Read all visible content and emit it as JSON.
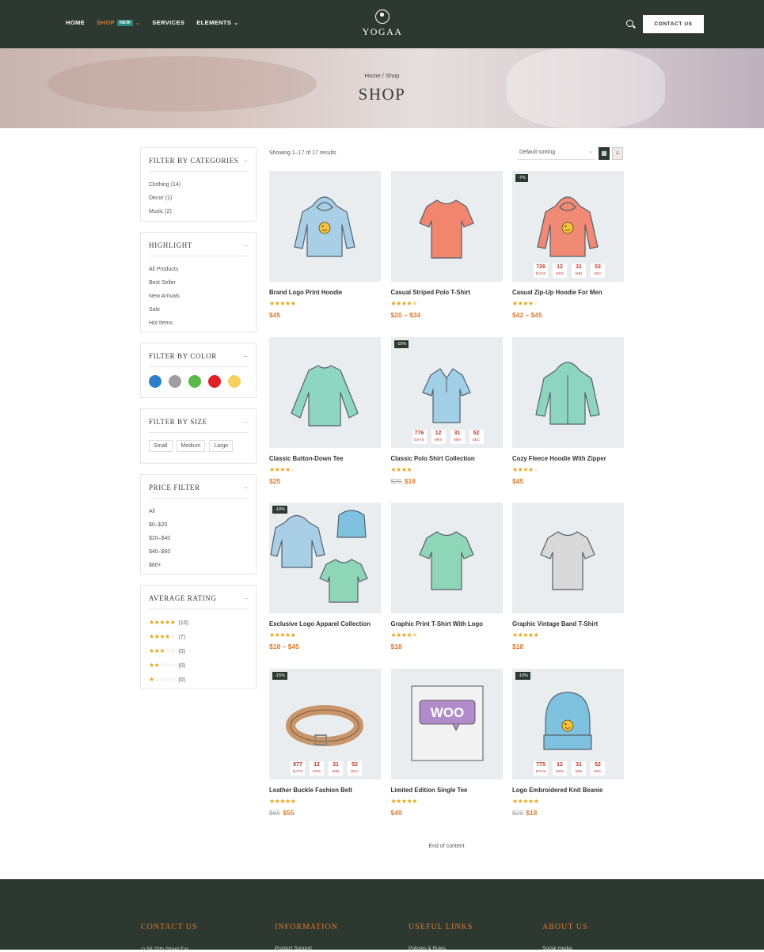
{
  "header": {
    "nav": [
      {
        "label": "HOME"
      },
      {
        "label": "SHOP",
        "badge": "NEW",
        "active": true
      },
      {
        "label": "SERVICES"
      },
      {
        "label": "ELEMENTS"
      }
    ],
    "logo_text": "YOGAA",
    "contact_label": "CONTACT US"
  },
  "hero": {
    "breadcrumb": "Home / Shop",
    "title": "SHOP"
  },
  "sidebar": {
    "categories": {
      "title": "FILTER BY CATEGORIES",
      "items": [
        "Clothing (14)",
        "Decor (1)",
        "Music (2)"
      ]
    },
    "highlight": {
      "title": "HIGHLIGHT",
      "items": [
        "All Products",
        "Best Seller",
        "New Arrivals",
        "Sale",
        "Hot Items"
      ]
    },
    "color": {
      "title": "FILTER BY COLOR",
      "colors": [
        "#2e7fc9",
        "#9e9e9e",
        "#58b94a",
        "#df2026",
        "#f7d060"
      ]
    },
    "size": {
      "title": "FILTER BY SIZE",
      "items": [
        "Small",
        "Medium",
        "Large"
      ]
    },
    "price": {
      "title": "PRICE FILTER",
      "items": [
        "All",
        "$0–$20",
        "$20–$40",
        "$40–$60",
        "$80+"
      ]
    },
    "rating": {
      "title": "AVERAGE RATING",
      "items": [
        {
          "stars": 5,
          "count": "(10)"
        },
        {
          "stars": 4,
          "count": "(7)"
        },
        {
          "stars": 3,
          "count": "(0)"
        },
        {
          "stars": 2,
          "count": "(0)"
        },
        {
          "stars": 1,
          "count": "(0)"
        }
      ]
    }
  },
  "toolbar": {
    "showing": "Showing 1–17 of 17 results",
    "sort": "Default sorting"
  },
  "products": [
    {
      "name": "Brand Logo Print Hoodie",
      "price": "$45",
      "rating": 5,
      "icon": "hoodie",
      "color": "#a9cfe6"
    },
    {
      "name": "Casual Striped Polo T-Shirt",
      "price": "$20 – $34",
      "rating": 4.5,
      "icon": "tshirt",
      "color": "#f2856e"
    },
    {
      "name": "Casual Zip-Up Hoodie For Men",
      "price": "$42 – $45",
      "rating": 4,
      "icon": "hoodie",
      "color": "#f08a74",
      "tag": "-7%",
      "countdown": [
        "726",
        "12",
        "31",
        "53"
      ]
    },
    {
      "name": "Classic Button-Down Tee",
      "price": "$25",
      "rating": 4,
      "icon": "longsleeve",
      "color": "#8fd6c0"
    },
    {
      "name": "Classic Polo Shirt Collection",
      "old": "$20",
      "price": "$18",
      "rating": 4,
      "icon": "polo",
      "color": "#a2cfe8",
      "tag": "-10%",
      "countdown": [
        "776",
        "12",
        "31",
        "52"
      ]
    },
    {
      "name": "Cozy Fleece Hoodie With Zipper",
      "price": "$45",
      "rating": 4,
      "icon": "zip",
      "color": "#8dd5be"
    },
    {
      "name": "Exclusive Logo Apparel Collection",
      "price": "$18 – $45",
      "rating": 5,
      "icon": "bundle",
      "color": "#a9cfe6",
      "tag": "-10%"
    },
    {
      "name": "Graphic Print T-Shirt With Logo",
      "price": "$18",
      "rating": 4.5,
      "icon": "tshirt",
      "color": "#8fd6b8"
    },
    {
      "name": "Graphic Vintage Band T-Shirt",
      "price": "$18",
      "rating": 5,
      "icon": "tshirt",
      "color": "#d8d8d8"
    },
    {
      "name": "Leather Buckle Fashion Belt",
      "old": "$65",
      "price": "$55",
      "rating": 5,
      "icon": "belt",
      "color": "#c8946a",
      "tag": "-15%",
      "countdown": [
        "877",
        "12",
        "31",
        "52"
      ]
    },
    {
      "name": "Limited Edition Single Tee",
      "price": "$49",
      "rating": 5,
      "icon": "woo",
      "color": "#b08cc9"
    },
    {
      "name": "Logo Embroidered Knit Beanie",
      "old": "$20",
      "price": "$18",
      "rating": 5,
      "icon": "beanie",
      "color": "#7fc2e0",
      "tag": "-10%",
      "countdown": [
        "775",
        "12",
        "31",
        "52"
      ]
    }
  ],
  "countdown_labels": [
    "DAYS",
    "HRS",
    "MIN",
    "SEC"
  ],
  "woo_text": "WOO",
  "end_text": "End of content",
  "footer": {
    "columns": [
      {
        "title": "CONTACT US",
        "first": "59 20th Street Ear"
      },
      {
        "title": "INFORMATION",
        "first": "Product Support"
      },
      {
        "title": "USEFUL LINKS",
        "first": "Policies & Rules"
      },
      {
        "title": "ABOUT US",
        "first": "Social media"
      }
    ]
  }
}
